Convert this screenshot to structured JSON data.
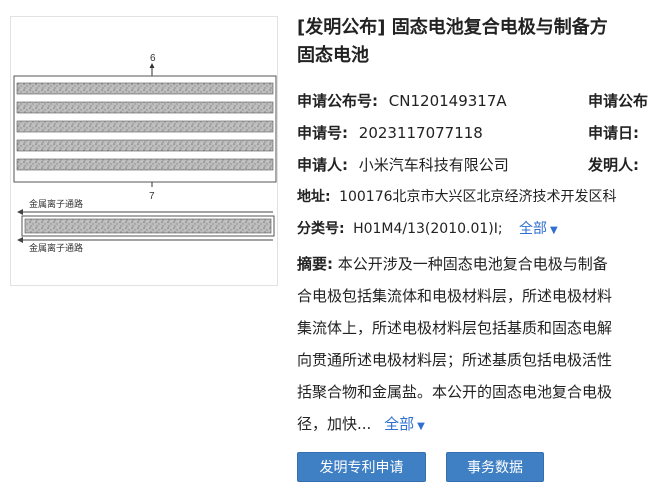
{
  "thumbnail": {
    "label_top": "6",
    "label_bottom": "7",
    "channel_label_1": "金属离子通路",
    "channel_label_2": "金属离子通路"
  },
  "title": {
    "line1": "[发明公布] 固态电池复合电极与制备方",
    "line2": "固态电池"
  },
  "fields": {
    "pub_no_label": "申请公布号:",
    "pub_no_value": "CN120149317A",
    "pub_date_label": "申请公布",
    "app_no_label": "申请号:",
    "app_no_value": "2023117077118",
    "app_date_label": "申请日:",
    "applicant_label": "申请人:",
    "applicant_value": "小米汽车科技有限公司",
    "inventor_label": "发明人:",
    "address_label": "地址:",
    "address_value": "100176北京市大兴区北京经济技术开发区科",
    "class_label": "分类号:",
    "class_value": "H01M4/13(2010.01)I;",
    "class_more": "全部"
  },
  "abstract": {
    "label": "摘要:",
    "lines": [
      "本公开涉及一种固态电池复合电极与制备",
      "合电极包括集流体和电极材料层，所述电极材料",
      "集流体上，所述电极材料层包括基质和固态电解",
      "向贯通所述电极材料层；所述基质包括电极活性",
      "括聚合物和金属盐。本公开的固态电池复合电极",
      "径，加快..."
    ],
    "more": "全部"
  },
  "buttons": {
    "apply": "发明专利申请",
    "affairs": "事务数据"
  }
}
